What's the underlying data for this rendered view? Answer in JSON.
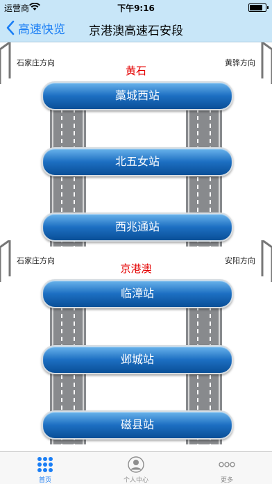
{
  "status_bar": {
    "carrier": "运营商",
    "time": "下午9:16",
    "battery_level": 0.85
  },
  "nav": {
    "back_label": "高速快览",
    "title": "京港澳高速石安段"
  },
  "sections": [
    {
      "city": "黄石",
      "left_direction": "石家庄方向",
      "right_direction": "黄骅方向",
      "stations": [
        "藁城西站",
        "北五女站",
        "西兆通站"
      ]
    },
    {
      "city": "京港澳",
      "left_direction": "石家庄方向",
      "right_direction": "安阳方向",
      "stations": [
        "临漳站",
        "邺城站",
        "磁县站"
      ]
    }
  ],
  "tabs": [
    {
      "label": "首页",
      "icon": "grid-icon",
      "active": true
    },
    {
      "label": "个人中心",
      "icon": "person-icon",
      "active": false
    },
    {
      "label": "更多",
      "icon": "more-icon",
      "active": false
    }
  ],
  "colors": {
    "accent": "#1a7ef5",
    "nav_bg": "#c8e6f8",
    "city_red": "#e40000",
    "station_blue": "#1d6fc2"
  }
}
